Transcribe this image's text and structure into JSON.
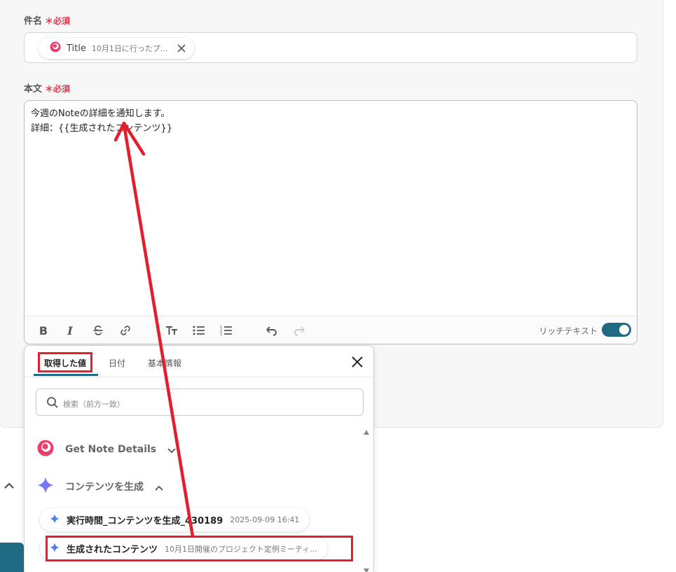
{
  "subject": {
    "label": "件名",
    "required": "＊必須",
    "chip_title": "Title",
    "chip_value": "10月1日に行ったプ..."
  },
  "body": {
    "label": "本文",
    "required": "＊必須",
    "line1": "今週のNoteの詳細を通知します。",
    "line2": "詳細：{{生成されたコンテンツ}}"
  },
  "toolbar": {
    "rich_text_label": "リッチテキスト",
    "rich_text_on": true
  },
  "popup": {
    "tabs": [
      "取得した値",
      "日付",
      "基本情報"
    ],
    "search_placeholder": "検索（前方一致）",
    "groups": [
      {
        "label": "Get Note Details",
        "expanded": false
      },
      {
        "label": "コンテンツを生成",
        "expanded": true
      }
    ],
    "items": [
      {
        "name": "実行時間_コンテンツを生成_430189",
        "value": "2025-09-09 16:41"
      },
      {
        "name": "生成されたコンテンツ",
        "value": "10月1日開催のプロジェクト定例ミーティ..."
      }
    ]
  },
  "colors": {
    "accent": "#1f6b84",
    "required": "#e8334a",
    "annotation": "#e31e2e"
  }
}
